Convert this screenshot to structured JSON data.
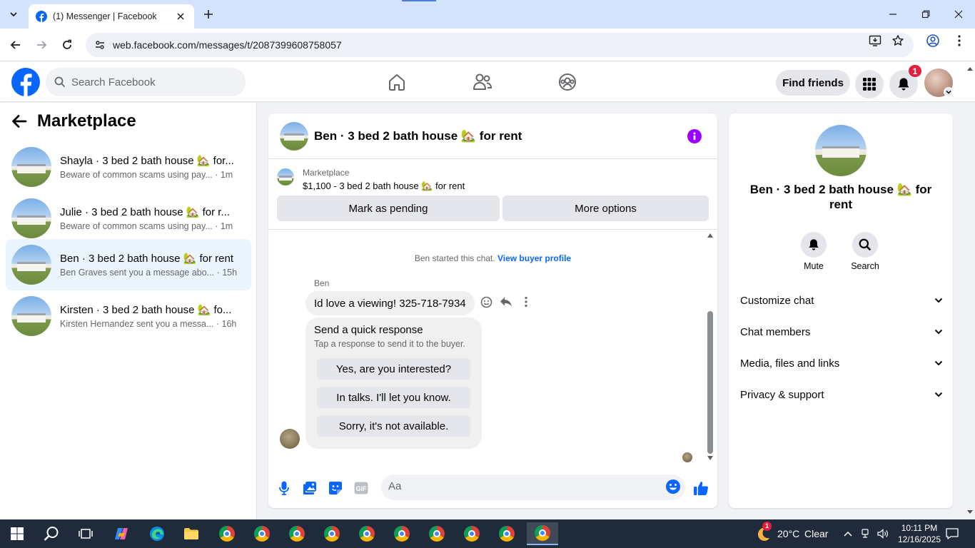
{
  "browser": {
    "tab_title": "(1) Messenger | Facebook",
    "url": "web.facebook.com/messages/t/2087399608758057"
  },
  "fb_header": {
    "search_placeholder": "Search Facebook",
    "find_friends": "Find friends",
    "notification_count": "1"
  },
  "sidebar": {
    "title": "Marketplace",
    "conversations": [
      {
        "title": "Shayla · 3 bed 2 bath house 🏡 for...",
        "preview": "Beware of common scams using pay...",
        "time": " · 1m"
      },
      {
        "title": "Julie · 3 bed 2 bath house 🏡 for r...",
        "preview": "Beware of common scams using pay...",
        "time": " · 1m"
      },
      {
        "title": "Ben · 3 bed 2 bath house 🏡 for rent",
        "preview": "Ben Graves sent you a message abo...",
        "time": " · 15h"
      },
      {
        "title": "Kirsten · 3 bed 2 bath house 🏡 fo...",
        "preview": "Kirsten Hernandez sent you a messa...",
        "time": " · 16h"
      }
    ]
  },
  "chat": {
    "title": "Ben · 3 bed 2 bath house 🏡 for rent",
    "listing_label": "Marketplace",
    "listing_price": "$1,100 - 3 bed 2 bath house 🏡 for rent",
    "mark_pending": "Mark as pending",
    "more_options": "More options",
    "system_message": "Ben started this chat.",
    "view_buyer_profile": "View buyer profile",
    "sender_name": "Ben",
    "message_text": "Id love a viewing! 325-718-7934",
    "quick_title": "Send a quick response",
    "quick_subtitle": "Tap a response to send it to the buyer.",
    "quick_options": [
      "Yes, are you interested?",
      "In talks. I'll let you know.",
      "Sorry, it's not available."
    ],
    "composer_placeholder": "Aa"
  },
  "right_panel": {
    "title": "Ben · 3 bed 2 bath house 🏡 for rent",
    "mute": "Mute",
    "search": "Search",
    "sections": [
      "Customize chat",
      "Chat members",
      "Media, files and links",
      "Privacy & support"
    ]
  },
  "taskbar": {
    "weather_temp": "20°C",
    "weather_desc": "Clear",
    "weather_badge": "1",
    "time": "10:11 PM",
    "date": "12/16/2025"
  },
  "colors": {
    "fb_blue": "#0866ff",
    "messenger_accent": "#9d00ff",
    "badge_red": "#e41e3f",
    "active_conv_bg": "#ebf5ff",
    "taskbar_bg": "#1f2a3a"
  }
}
